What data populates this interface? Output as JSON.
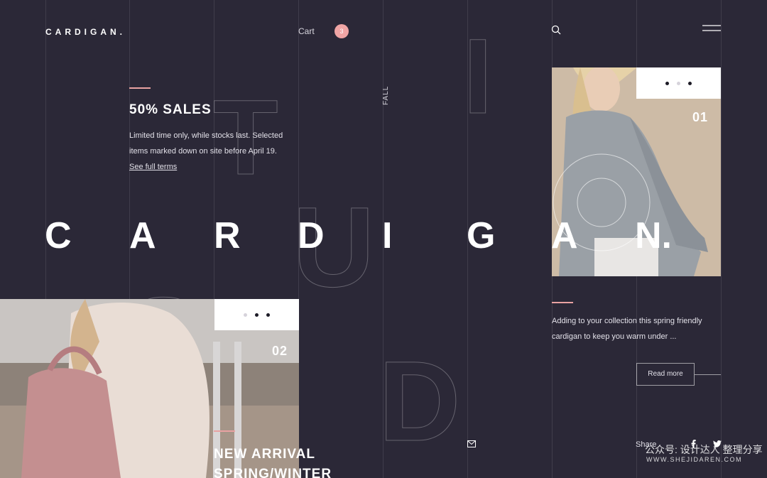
{
  "header": {
    "logo": "CARDIGAN.",
    "cart_label": "Cart",
    "cart_count": "3"
  },
  "sales": {
    "title": "50% SALES",
    "text": "Limited time only, while stocks last. Selected items marked down on site before April 19.",
    "link": "See full terms"
  },
  "side_label": "FALL",
  "hero_letters": [
    "C",
    "A",
    "R",
    "D",
    "I",
    "G",
    "A",
    "N."
  ],
  "outline_letters": [
    "T",
    "I",
    "U",
    "S",
    "D"
  ],
  "card_right": {
    "number": "01",
    "description": "Adding to your collection this spring friendly cardigan to keep you warm under ...",
    "button": "Read more"
  },
  "card_left": {
    "number": "02",
    "heading_line1": "NEW ARRIVAL",
    "heading_line2": "SPRING/WINTER"
  },
  "footer": {
    "share_label": "Share",
    "watermark_cn": "公众号: 设计达人 整理分享",
    "watermark_en": "WWW.SHEJIDAREN.COM"
  },
  "colors": {
    "background": "#2b2837",
    "accent": "#e9a2a2",
    "badge": "#f0a5a5",
    "text": "#ffffff"
  },
  "icons": [
    "search-icon",
    "menu-icon",
    "mail-icon",
    "facebook-icon",
    "twitter-icon"
  ]
}
